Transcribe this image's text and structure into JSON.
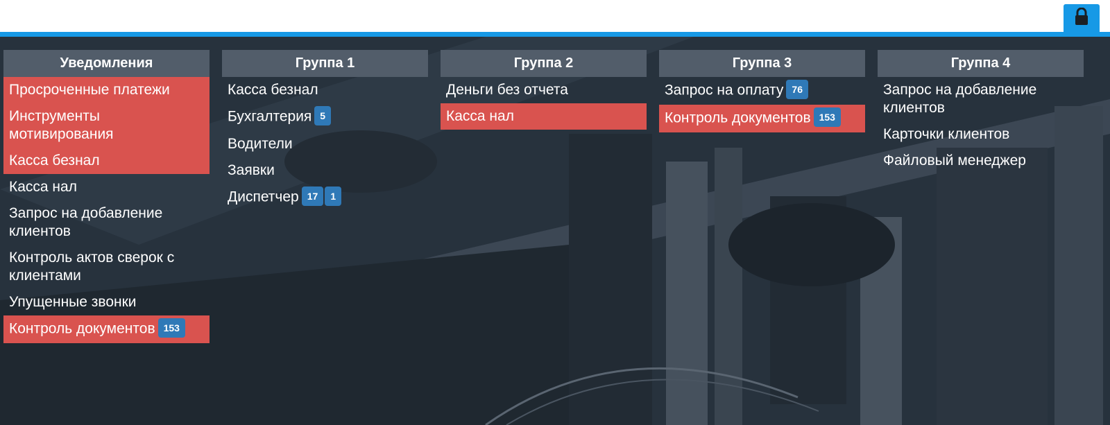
{
  "columns": [
    {
      "title": "Уведомления",
      "items": [
        {
          "label": "Просроченные платежи",
          "alert": true,
          "badges": []
        },
        {
          "label": "Инструменты мотивирования",
          "alert": true,
          "badges": []
        },
        {
          "label": "Касса безнал",
          "alert": true,
          "badges": []
        },
        {
          "label": "Касса нал",
          "alert": false,
          "badges": []
        },
        {
          "label": "Запрос на добавление клиентов",
          "alert": false,
          "badges": []
        },
        {
          "label": "Контроль актов сверок с клиентами",
          "alert": false,
          "badges": []
        },
        {
          "label": "Упущенные звонки",
          "alert": false,
          "badges": []
        },
        {
          "label": "Контроль документов",
          "alert": true,
          "badges": [
            "153"
          ]
        }
      ]
    },
    {
      "title": "Группа 1",
      "items": [
        {
          "label": "Касса безнал",
          "alert": false,
          "badges": []
        },
        {
          "label": "Бухгалтерия",
          "alert": false,
          "badges": [
            "5"
          ]
        },
        {
          "label": "Водители",
          "alert": false,
          "badges": []
        },
        {
          "label": "Заявки",
          "alert": false,
          "badges": []
        },
        {
          "label": "Диспетчер",
          "alert": false,
          "badges": [
            "17",
            "1"
          ]
        }
      ]
    },
    {
      "title": "Группа 2",
      "items": [
        {
          "label": "Деньги без отчета",
          "alert": false,
          "badges": []
        },
        {
          "label": "Касса нал",
          "alert": true,
          "badges": []
        }
      ]
    },
    {
      "title": "Группа 3",
      "items": [
        {
          "label": "Запрос на оплату",
          "alert": false,
          "badges": [
            "76"
          ]
        },
        {
          "label": "Контроль документов",
          "alert": true,
          "badges": [
            "153"
          ]
        }
      ]
    },
    {
      "title": "Группа 4",
      "items": [
        {
          "label": "Запрос на добавление клиентов",
          "alert": false,
          "badges": []
        },
        {
          "label": "Карточки клиентов",
          "alert": false,
          "badges": []
        },
        {
          "label": "Файловый менеджер",
          "alert": false,
          "badges": []
        }
      ]
    }
  ],
  "colors": {
    "accent": "#1799e6",
    "alert": "#d9534f",
    "badge": "#2f79b7",
    "header": "#525d6a",
    "background": "#27323d"
  },
  "icons": {
    "lock": "lock-icon"
  }
}
